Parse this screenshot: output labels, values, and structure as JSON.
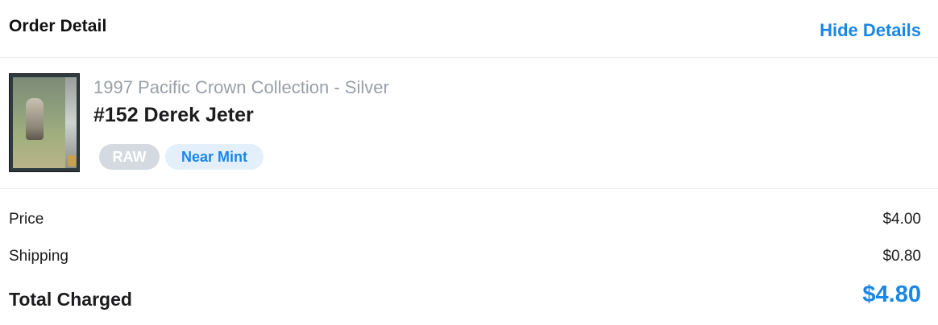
{
  "header": {
    "title": "Order Detail",
    "toggle_label": "Hide Details"
  },
  "item": {
    "thumbnail_icon": "baseball-card-thumbnail",
    "set_name": "1997 Pacific Crown Collection - Silver",
    "card_name": "#152 Derek Jeter",
    "badges": {
      "grade": "RAW",
      "condition": "Near Mint"
    }
  },
  "summary": {
    "price_label": "Price",
    "price_value": "$4.00",
    "shipping_label": "Shipping",
    "shipping_value": "$0.80",
    "total_label": "Total Charged",
    "total_value": "$4.80"
  },
  "colors": {
    "accent": "#1a86e6",
    "muted_text": "#9aa0a6",
    "raw_badge_bg": "#d5dae0",
    "condition_badge_bg": "#e3f0fc"
  }
}
